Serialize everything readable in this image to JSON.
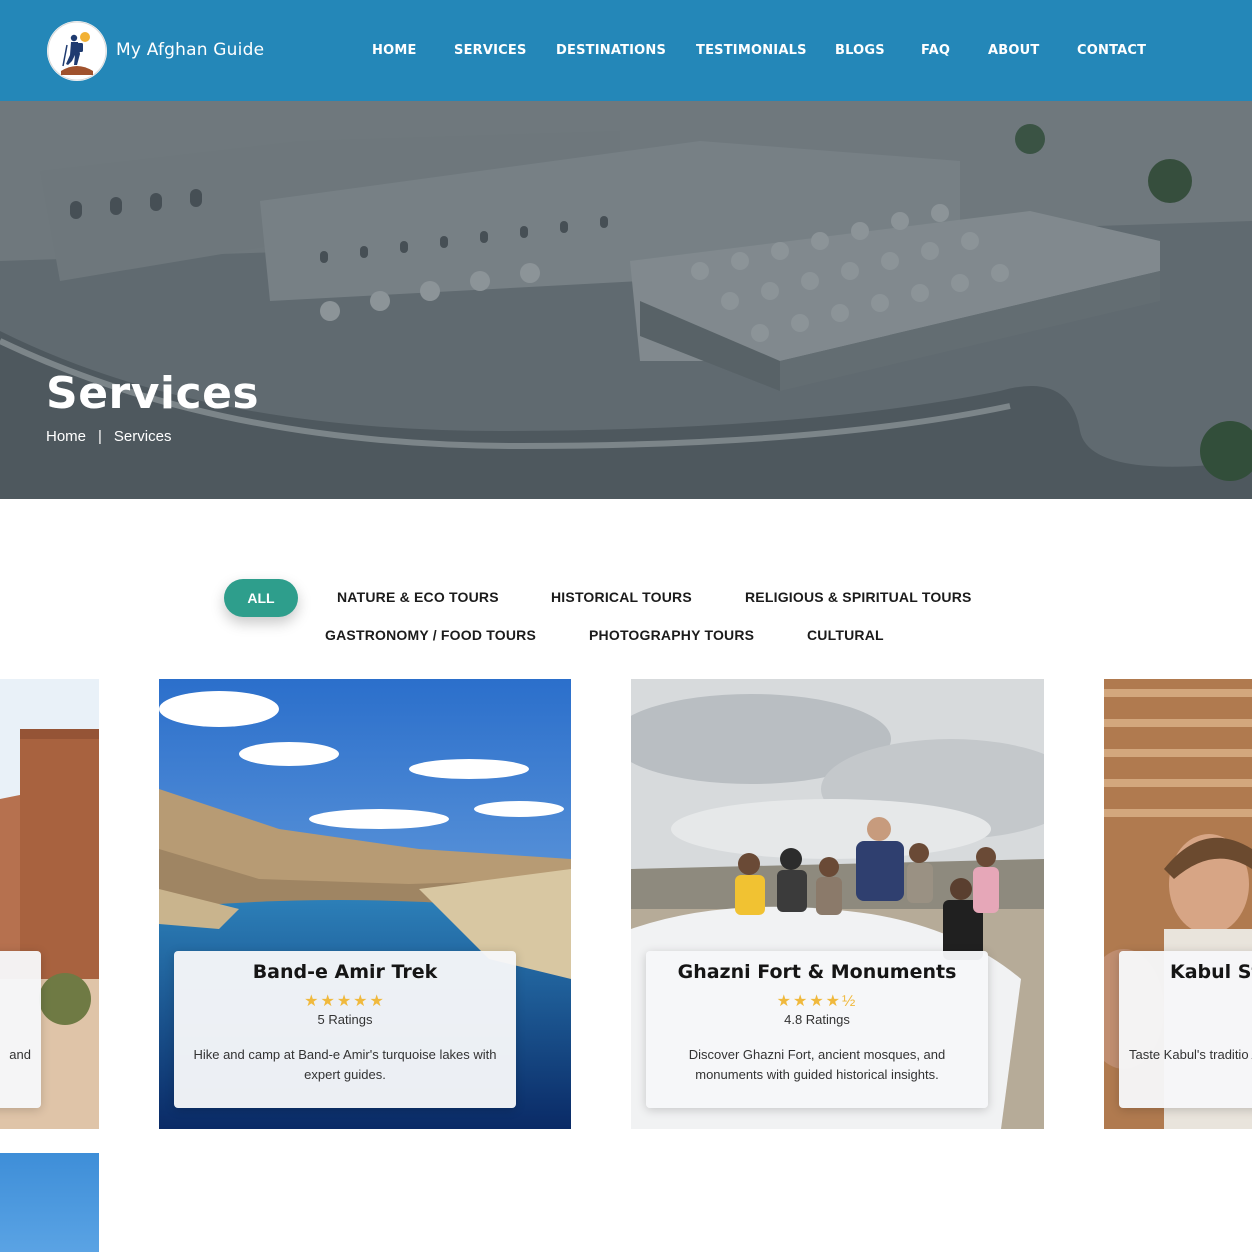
{
  "brand": {
    "name": "My Afghan Guide",
    "logo_icon": "hiker-logo-icon"
  },
  "nav": [
    "HOME",
    "SERVICES",
    "DESTINATIONS",
    "TESTIMONIALS",
    "BLOGS",
    "FAQ",
    "ABOUT",
    "CONTACT"
  ],
  "hero": {
    "title": "Services",
    "breadcrumb": {
      "home": "Home",
      "separator": "|",
      "current": "Services"
    }
  },
  "filters": {
    "active": "ALL",
    "items": [
      "NATURE & ECO TOURS",
      "HISTORICAL TOURS",
      "RELIGIOUS & SPIRITUAL TOURS",
      "GASTRONOMY / FOOD TOURS",
      "PHOTOGRAPHY TOURS",
      "CULTURAL"
    ]
  },
  "cards": [
    {
      "title": "",
      "stars": "",
      "ratings": "",
      "desc": "and"
    },
    {
      "title": "Band-e Amir Trek",
      "stars": "★★★★★",
      "ratings": "5 Ratings",
      "desc": "Hike and camp at Band-e Amir's turquoise lakes with expert guides."
    },
    {
      "title": "Ghazni Fort & Monuments",
      "stars": "★★★★½",
      "ratings": "4.8 Ratings",
      "desc": "Discover Ghazni Fort, ancient mosques, and monuments with guided historical insights."
    },
    {
      "title": "Kabul St",
      "stars": "",
      "ratings": "",
      "desc": "Taste Kabul's traditio Afghan"
    }
  ],
  "colors": {
    "header": "#2487b8",
    "accent": "#2e9e8c",
    "star": "#f0b93d"
  }
}
